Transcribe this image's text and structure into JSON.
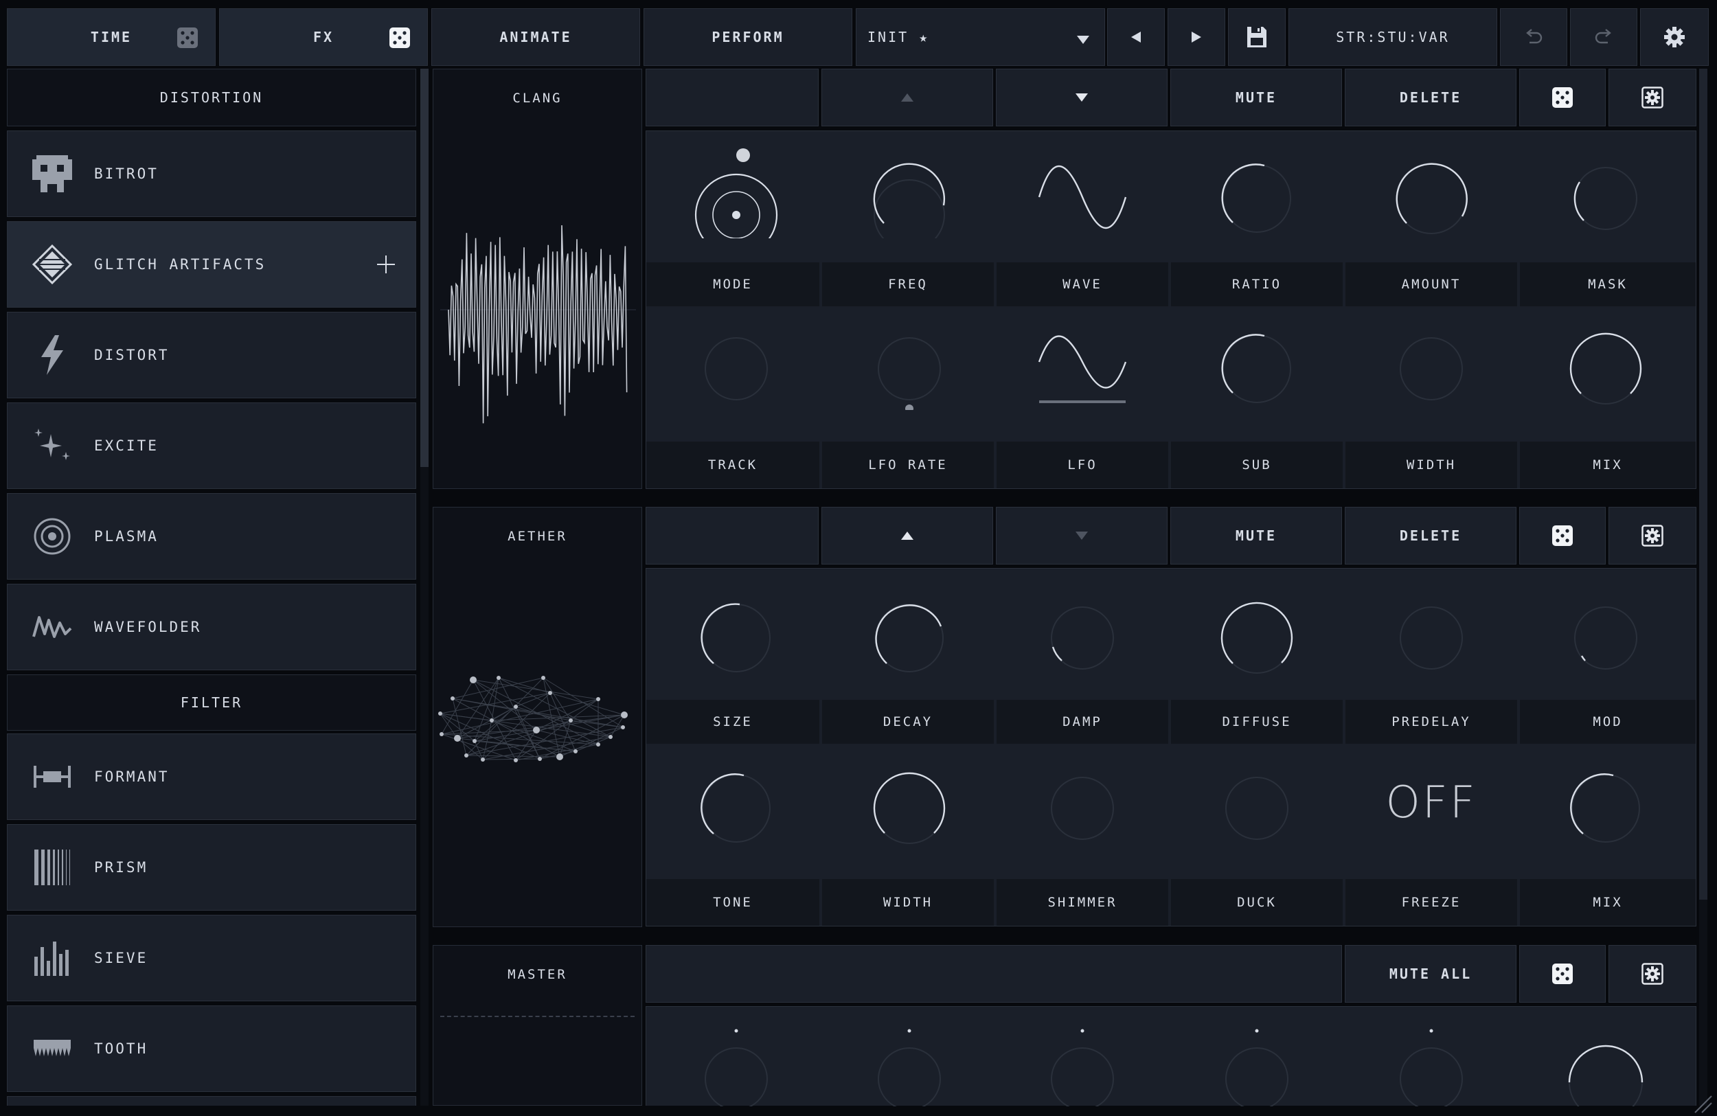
{
  "topbar": {
    "time": "TIME",
    "fx": "FX",
    "animate": "ANIMATE",
    "perform": "PERFORM",
    "preset": "INIT ★",
    "variation": "STR:STU:VAR"
  },
  "sidebar": {
    "section_distortion": "DISTORTION",
    "section_filter": "FILTER",
    "items_distortion": [
      {
        "label": "BITROT",
        "icon": "pixel-skull-icon"
      },
      {
        "label": "GLITCH ARTIFACTS",
        "icon": "glitch-diamond-icon"
      },
      {
        "label": "DISTORT",
        "icon": "lightning-icon"
      },
      {
        "label": "EXCITE",
        "icon": "sparkle-icon"
      },
      {
        "label": "PLASMA",
        "icon": "target-ring-icon"
      },
      {
        "label": "WAVEFOLDER",
        "icon": "zigzag-wave-icon"
      }
    ],
    "items_filter": [
      {
        "label": "FORMANT",
        "icon": "formant-icon"
      },
      {
        "label": "PRISM",
        "icon": "prism-bars-icon"
      },
      {
        "label": "SIEVE",
        "icon": "sieve-bars-icon"
      },
      {
        "label": "TOOTH",
        "icon": "tooth-comb-icon"
      }
    ]
  },
  "modules": {
    "clang": {
      "title": "CLANG",
      "mute": "MUTE",
      "delete": "DELETE",
      "row1": [
        "MODE",
        "FREQ",
        "WAVE",
        "RATIO",
        "AMOUNT",
        "MASK"
      ],
      "row2": [
        "TRACK",
        "LFO RATE",
        "LFO",
        "SUB",
        "WIDTH",
        "MIX"
      ]
    },
    "aether": {
      "title": "AETHER",
      "mute": "MUTE",
      "delete": "DELETE",
      "row1": [
        "SIZE",
        "DECAY",
        "DAMP",
        "DIFFUSE",
        "PREDELAY",
        "MOD"
      ],
      "row2": [
        "TONE",
        "WIDTH",
        "SHIMMER",
        "DUCK",
        "FREEZE",
        "MIX"
      ],
      "freeze_value": "OFF"
    },
    "master": {
      "title": "MASTER",
      "mute_all": "MUTE ALL"
    }
  },
  "colors": {
    "background": "#07090d",
    "panel": "#1a1f29",
    "label_bg": "#12161d",
    "accent": "#d9dee7"
  }
}
